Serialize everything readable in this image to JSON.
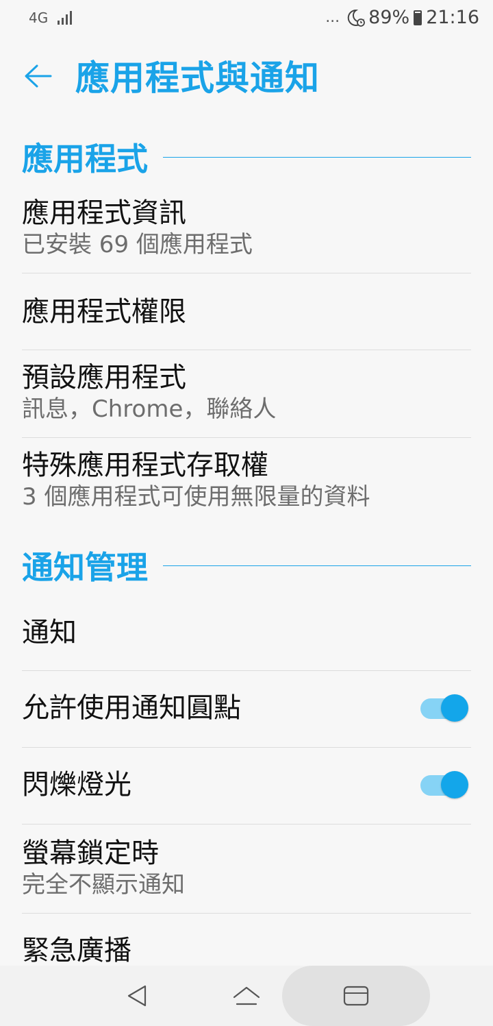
{
  "status_bar": {
    "network": "4G",
    "dots": "...",
    "battery": "89%",
    "time": "21:16"
  },
  "header": {
    "title": "應用程式與通知"
  },
  "sections": {
    "apps": {
      "title": "應用程式",
      "items": [
        {
          "title": "應用程式資訊",
          "subtitle": "已安裝 69 個應用程式"
        },
        {
          "title": "應用程式權限"
        },
        {
          "title": "預設應用程式",
          "subtitle": "訊息，Chrome，聯絡人"
        },
        {
          "title": "特殊應用程式存取權",
          "subtitle": "3 個應用程式可使用無限量的資料"
        }
      ]
    },
    "notifications": {
      "title": "通知管理",
      "items": [
        {
          "title": "通知"
        },
        {
          "title": "允許使用通知圓點",
          "toggle_on": true
        },
        {
          "title": "閃爍燈光",
          "toggle_on": true
        },
        {
          "title": "螢幕鎖定時",
          "subtitle": "完全不顯示通知"
        },
        {
          "title": "緊急廣播"
        }
      ]
    }
  },
  "colors": {
    "accent": "#1aa3e8",
    "toggle_track": "#86d3f5",
    "toggle_thumb": "#13a6ea"
  },
  "icons": {
    "back": "arrow-left-icon",
    "nav_back": "triangle-back-icon",
    "nav_home": "home-icon",
    "nav_recent": "recent-apps-icon"
  }
}
